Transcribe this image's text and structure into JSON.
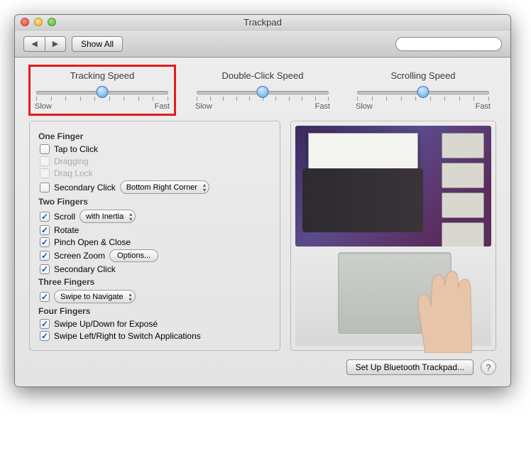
{
  "window": {
    "title": "Trackpad"
  },
  "toolbar": {
    "show_all": "Show All",
    "search_placeholder": ""
  },
  "sliders": {
    "tracking": {
      "title": "Tracking Speed",
      "min": "Slow",
      "max": "Fast",
      "position": 50
    },
    "doubleclick": {
      "title": "Double-Click Speed",
      "min": "Slow",
      "max": "Fast",
      "position": 50
    },
    "scrolling": {
      "title": "Scrolling Speed",
      "min": "Slow",
      "max": "Fast",
      "position": 50
    }
  },
  "groups": {
    "one_finger": {
      "title": "One Finger",
      "tap_to_click": "Tap to Click",
      "dragging": "Dragging",
      "drag_lock": "Drag Lock",
      "secondary_click": "Secondary Click",
      "secondary_click_select": "Bottom Right Corner"
    },
    "two_fingers": {
      "title": "Two Fingers",
      "scroll": "Scroll",
      "scroll_select": "with Inertia",
      "rotate": "Rotate",
      "pinch": "Pinch Open & Close",
      "screen_zoom": "Screen Zoom",
      "screen_zoom_btn": "Options...",
      "secondary_click": "Secondary Click"
    },
    "three_fingers": {
      "title": "Three Fingers",
      "swipe_nav": "Swipe to Navigate"
    },
    "four_fingers": {
      "title": "Four Fingers",
      "expose": "Swipe Up/Down for Exposé",
      "switch_apps": "Swipe Left/Right to Switch Applications"
    }
  },
  "bottom": {
    "setup_bt": "Set Up Bluetooth Trackpad...",
    "help": "?"
  }
}
